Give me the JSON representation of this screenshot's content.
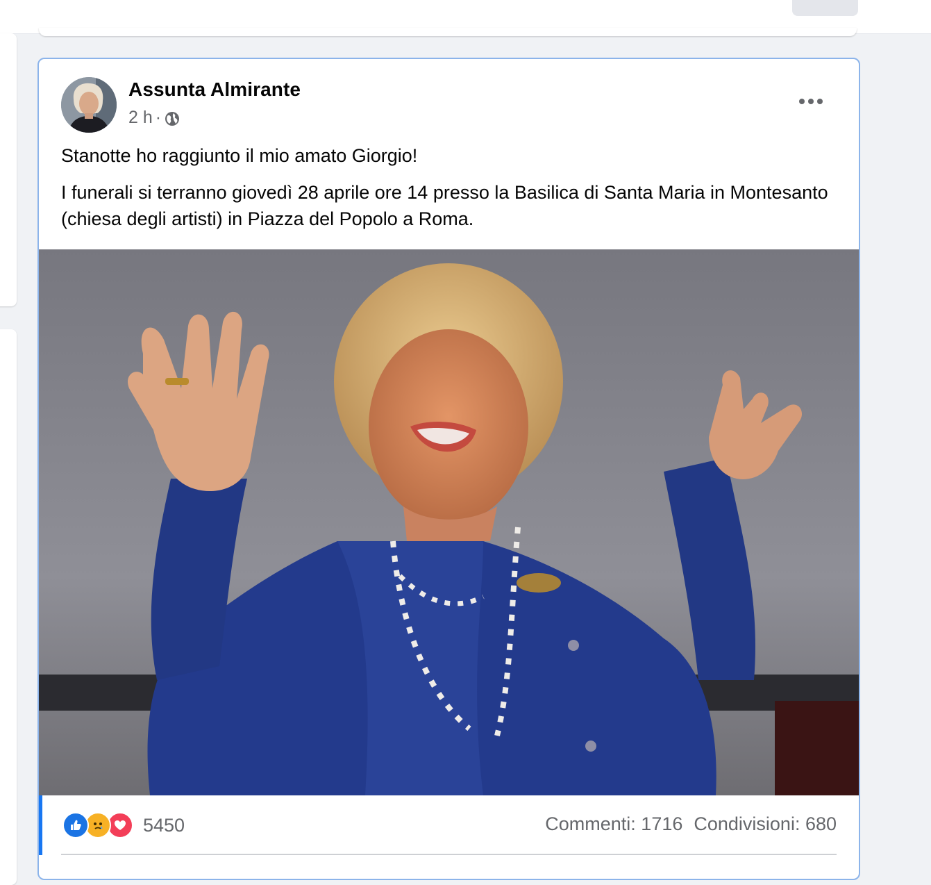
{
  "post": {
    "author": "Assunta Almirante",
    "time": "2 h",
    "separator": "·",
    "privacy_icon": "globe-icon",
    "more_icon": "more-horizontal-icon",
    "text": [
      "Stanotte ho raggiunto il mio amato Giorgio!",
      "I funerali si terranno giovedì 28 aprile ore 14 presso la Basilica di Santa Maria in Montesanto (chiesa degli artisti) in Piazza del Popolo a Roma."
    ],
    "photo": {
      "description": "photo-of-woman"
    },
    "reactions": {
      "icons": [
        "like-reaction-icon",
        "sad-reaction-icon",
        "love-reaction-icon"
      ],
      "count": "5450"
    },
    "comments": "Commenti: 1716",
    "shares": "Condivisioni: 680"
  },
  "colors": {
    "accent": "#1877f2",
    "card_border": "#8cb4ea",
    "secondary_text": "#65676b"
  }
}
